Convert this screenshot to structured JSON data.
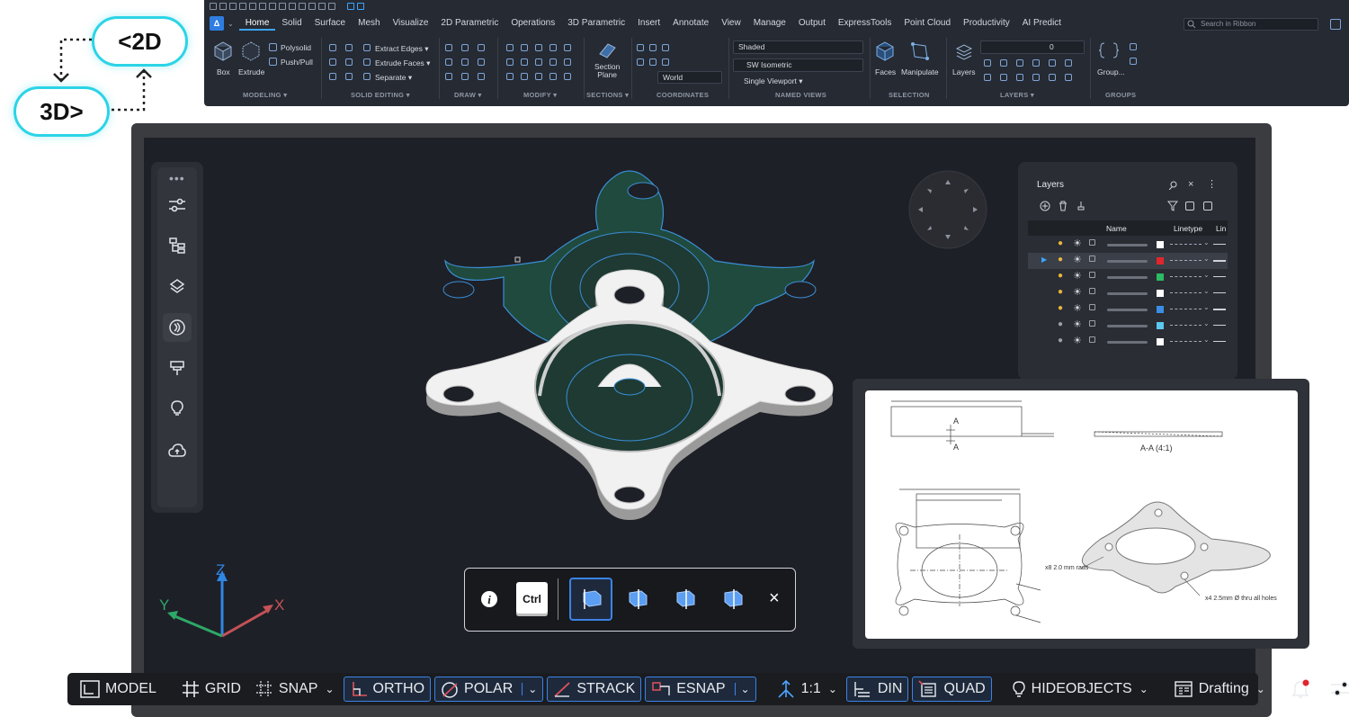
{
  "badges": {
    "label_2d": "<2D",
    "label_3d": "3D>"
  },
  "ribbon": {
    "tabs": [
      "Home",
      "Solid",
      "Surface",
      "Mesh",
      "Visualize",
      "2D Parametric",
      "Operations",
      "3D Parametric",
      "Insert",
      "Annotate",
      "View",
      "Manage",
      "Output",
      "ExpressTools",
      "Point Cloud",
      "Productivity",
      "AI Predict"
    ],
    "active_tab": "Home",
    "search_placeholder": "Search in Ribbon",
    "groups": {
      "modeling": {
        "label": "MODELING ▾",
        "box": "Box",
        "extrude": "Extrude",
        "polysolid": "Polysolid",
        "pushpull": "Push/Pull"
      },
      "solid_editing": {
        "label": "SOLID EDITING ▾",
        "extract_edges": "Extract Edges ▾",
        "extrude_faces": "Extrude Faces ▾",
        "separate": "Separate ▾"
      },
      "draw": {
        "label": "DRAW ▾"
      },
      "modify": {
        "label": "MODIFY ▾"
      },
      "sections": {
        "label": "SECTIONS ▾",
        "section_plane": "Section\nPlane"
      },
      "coordinates": {
        "label": "COORDINATES",
        "world": "World"
      },
      "named_views": {
        "label": "NAMED VIEWS",
        "visual_style": "Shaded",
        "view": "SW Isometric",
        "viewport": "Single Viewport ▾"
      },
      "selection": {
        "label": "SELECTION",
        "faces": "Faces",
        "manipulate": "Manipulate"
      },
      "layers": {
        "label": "LAYERS ▾",
        "layers_btn": "Layers",
        "current_layer": "0"
      },
      "groups": {
        "label": "GROUPS",
        "group_btn": "Group..."
      }
    }
  },
  "layers_panel": {
    "title": "Layers",
    "columns": {
      "name": "Name",
      "linetype": "Linetype",
      "lin": "Lin"
    },
    "row_colors": [
      "#ffffff",
      "#e0262b",
      "#2dbb63",
      "#ffffff",
      "#3a8ee6",
      "#5cc8ef",
      "#ffffff"
    ]
  },
  "drawing": {
    "section_label": "A-A (4:1)",
    "section_mark_top": "A",
    "section_mark_bottom": "A",
    "callout_rads": "x8 2.0 mm rads",
    "callout_holes": "x4 2.5mm Ø thru all holes"
  },
  "popup": {
    "ctrl_label": "Ctrl",
    "close_label": "×"
  },
  "status_bar": {
    "model": "MODEL",
    "grid": "GRID",
    "snap": "SNAP",
    "ortho": "ORTHO",
    "polar": "POLAR",
    "strack": "STRACK",
    "esnap": "ESNAP",
    "scale": "1:1",
    "din": "DIN",
    "quad": "QUAD",
    "hideobjects": "HIDEOBJECTS",
    "workspace": "Drafting"
  },
  "axes": {
    "x": "X",
    "y": "Y",
    "z": "Z"
  },
  "colors": {
    "accent": "#3c82e6",
    "badge": "#2bd4e6",
    "ghost_fill": "#1f4a3d",
    "ghost_stroke": "#3a8ed6"
  }
}
